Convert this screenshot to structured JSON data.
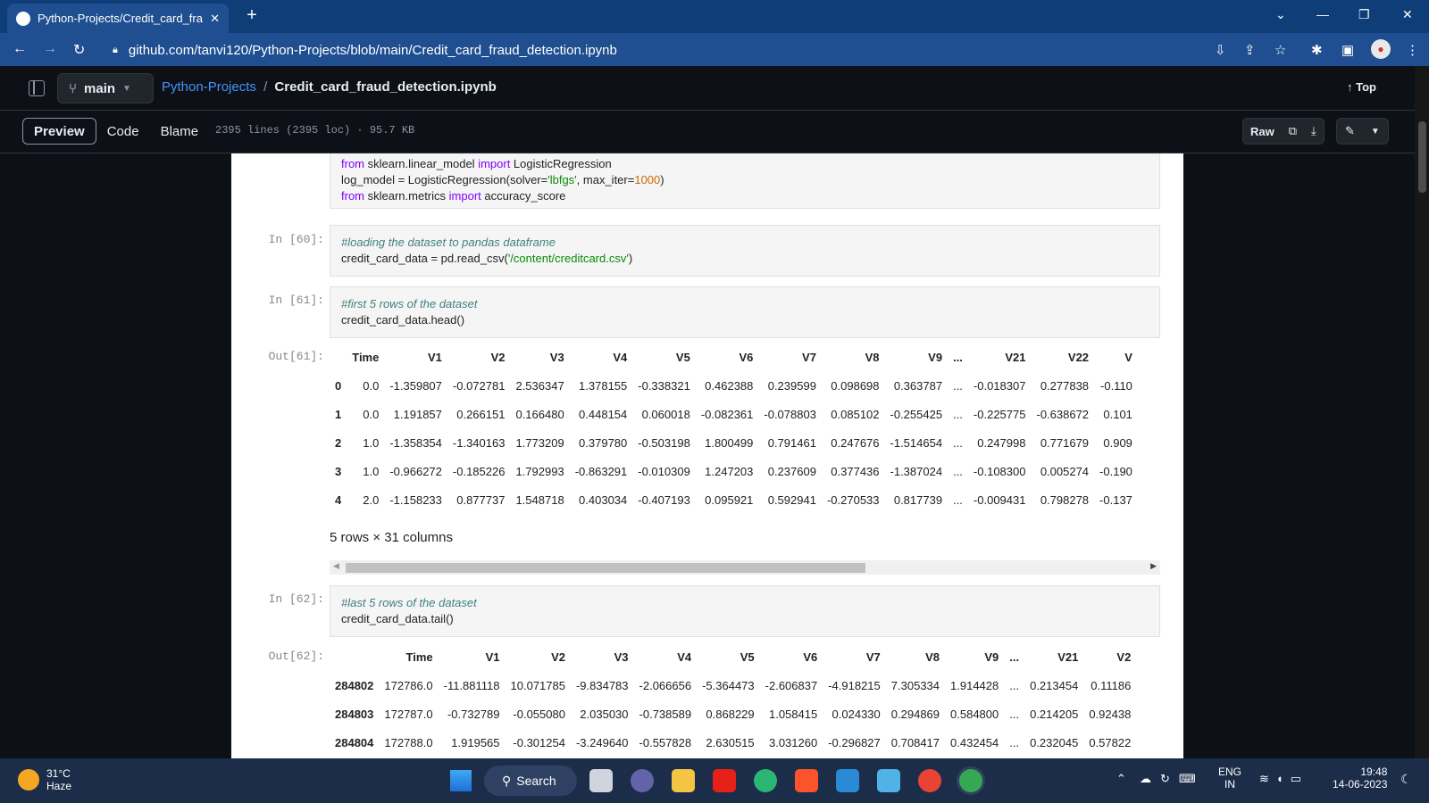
{
  "browser": {
    "tab_title": "Python-Projects/Credit_card_frau",
    "url": "github.com/tanvi120/Python-Projects/blob/main/Credit_card_fraud_detection.ipynb"
  },
  "header": {
    "branch": "main",
    "repo": "Python-Projects",
    "sep": "/",
    "file": "Credit_card_fraud_detection.ipynb",
    "top": "Top"
  },
  "toolbar": {
    "preview": "Preview",
    "code": "Code",
    "blame": "Blame",
    "info": "2395 lines (2395 loc) · 95.7 KB",
    "raw": "Raw"
  },
  "cells": {
    "c0": {
      "l1a": "from",
      "l1b": " sklearn.linear_model ",
      "l1c": "import",
      "l1d": " LogisticRegression",
      "l2a": "log_model = LogisticRegression(solver=",
      "l2b": "'lbfgs'",
      "l2c": ", max_iter=",
      "l2d": "1000",
      "l2e": ")",
      "l3a": "from",
      "l3b": " sklearn.metrics ",
      "l3c": "import",
      "l3d": " accuracy_score"
    },
    "c60": {
      "prompt": "In [60]:",
      "comment": "#loading the dataset to pandas dataframe",
      "a": "credit_card_data = pd.read_csv(",
      "b": "'/content/creditcard.csv'",
      "c": ")"
    },
    "c61": {
      "prompt": "In [61]:",
      "comment": "#first 5 rows of the dataset",
      "code": "credit_card_data.head()"
    },
    "o61": {
      "prompt": "Out[61]:",
      "shape": "5 rows × 31 columns"
    },
    "c62": {
      "prompt": "In [62]:",
      "comment": "#last 5 rows of the dataset",
      "code": "credit_card_data.tail()"
    },
    "o62": {
      "prompt": "Out[62]:"
    }
  },
  "head_table": {
    "columns": [
      "",
      "Time",
      "V1",
      "V2",
      "V3",
      "V4",
      "V5",
      "V6",
      "V7",
      "V8",
      "V9",
      "...",
      "V21",
      "V22",
      "V"
    ],
    "rows": [
      [
        "0",
        "0.0",
        "-1.359807",
        "-0.072781",
        "2.536347",
        "1.378155",
        "-0.338321",
        "0.462388",
        "0.239599",
        "0.098698",
        "0.363787",
        "...",
        "-0.018307",
        "0.277838",
        "-0.110"
      ],
      [
        "1",
        "0.0",
        "1.191857",
        "0.266151",
        "0.166480",
        "0.448154",
        "0.060018",
        "-0.082361",
        "-0.078803",
        "0.085102",
        "-0.255425",
        "...",
        "-0.225775",
        "-0.638672",
        "0.101"
      ],
      [
        "2",
        "1.0",
        "-1.358354",
        "-1.340163",
        "1.773209",
        "0.379780",
        "-0.503198",
        "1.800499",
        "0.791461",
        "0.247676",
        "-1.514654",
        "...",
        "0.247998",
        "0.771679",
        "0.909"
      ],
      [
        "3",
        "1.0",
        "-0.966272",
        "-0.185226",
        "1.792993",
        "-0.863291",
        "-0.010309",
        "1.247203",
        "0.237609",
        "0.377436",
        "-1.387024",
        "...",
        "-0.108300",
        "0.005274",
        "-0.190"
      ],
      [
        "4",
        "2.0",
        "-1.158233",
        "0.877737",
        "1.548718",
        "0.403034",
        "-0.407193",
        "0.095921",
        "0.592941",
        "-0.270533",
        "0.817739",
        "...",
        "-0.009431",
        "0.798278",
        "-0.137"
      ]
    ]
  },
  "tail_table": {
    "columns": [
      "",
      "Time",
      "V1",
      "V2",
      "V3",
      "V4",
      "V5",
      "V6",
      "V7",
      "V8",
      "V9",
      "...",
      "V21",
      "V2"
    ],
    "rows": [
      [
        "284802",
        "172786.0",
        "-11.881118",
        "10.071785",
        "-9.834783",
        "-2.066656",
        "-5.364473",
        "-2.606837",
        "-4.918215",
        "7.305334",
        "1.914428",
        "...",
        "0.213454",
        "0.11186"
      ],
      [
        "284803",
        "172787.0",
        "-0.732789",
        "-0.055080",
        "2.035030",
        "-0.738589",
        "0.868229",
        "1.058415",
        "0.024330",
        "0.294869",
        "0.584800",
        "...",
        "0.214205",
        "0.92438"
      ],
      [
        "284804",
        "172788.0",
        "1.919565",
        "-0.301254",
        "-3.249640",
        "-0.557828",
        "2.630515",
        "3.031260",
        "-0.296827",
        "0.708417",
        "0.432454",
        "...",
        "0.232045",
        "0.57822"
      ]
    ]
  },
  "taskbar": {
    "temp": "31°C",
    "weather": "Haze",
    "search": "Search",
    "lang1": "ENG",
    "lang2": "IN",
    "time": "19:48",
    "date": "14-06-2023"
  }
}
